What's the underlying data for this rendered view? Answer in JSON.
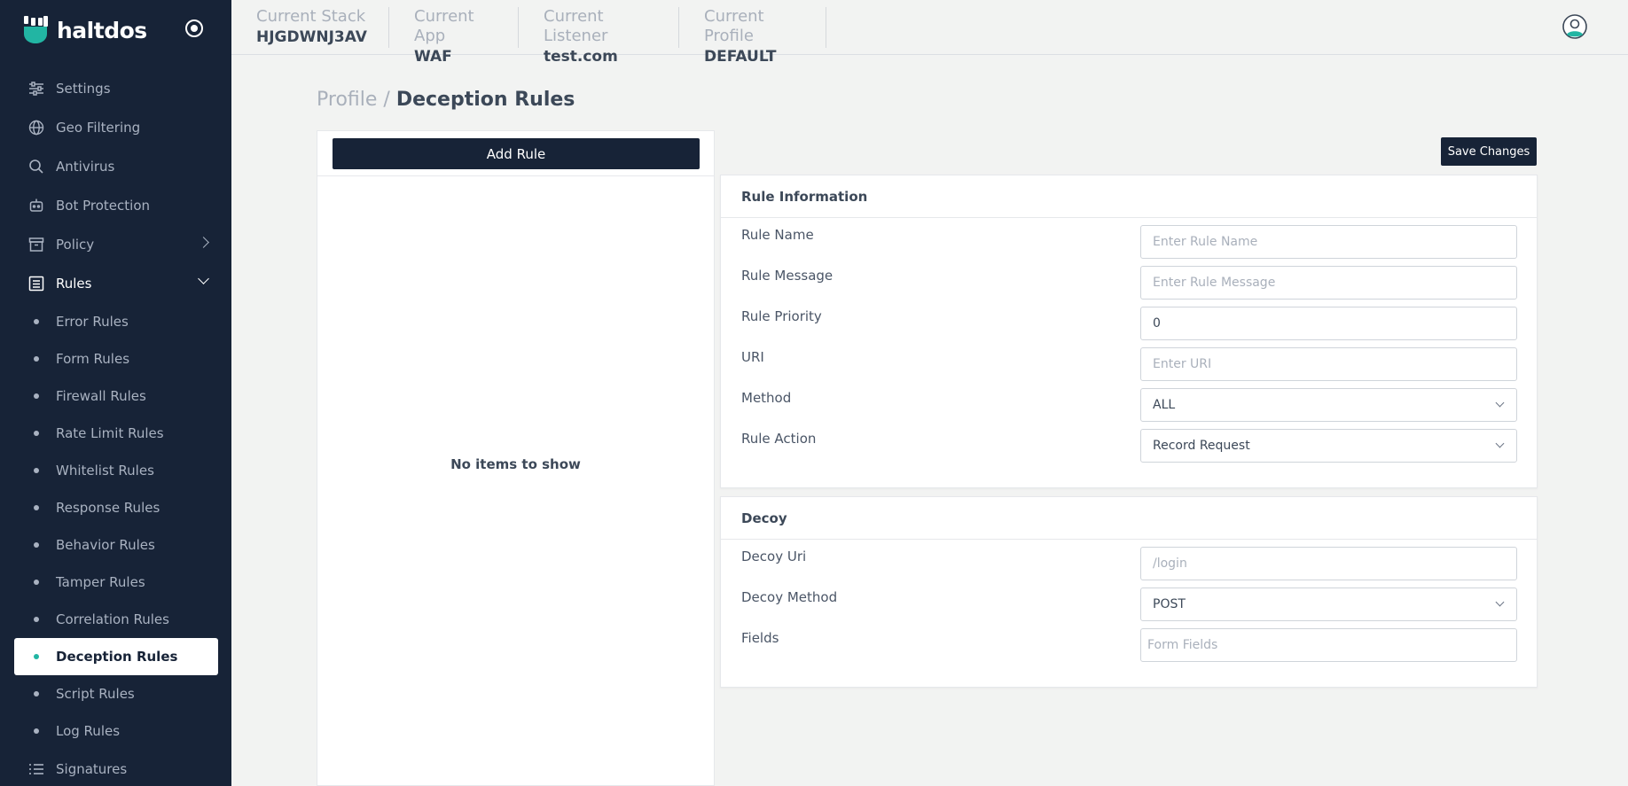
{
  "brand": {
    "name": "haltdos"
  },
  "sidebar": {
    "items": [
      {
        "label": "Settings",
        "icon": "sliders-icon"
      },
      {
        "label": "Geo Filtering",
        "icon": "globe-icon"
      },
      {
        "label": "Antivirus",
        "icon": "search-icon"
      },
      {
        "label": "Bot Protection",
        "icon": "robot-icon"
      },
      {
        "label": "Policy",
        "icon": "archive-icon"
      },
      {
        "label": "Rules",
        "icon": "list-icon"
      }
    ],
    "rules_sub": [
      {
        "label": "Error Rules"
      },
      {
        "label": "Form Rules"
      },
      {
        "label": "Firewall Rules"
      },
      {
        "label": "Rate Limit Rules"
      },
      {
        "label": "Whitelist Rules"
      },
      {
        "label": "Response Rules"
      },
      {
        "label": "Behavior Rules"
      },
      {
        "label": "Tamper Rules"
      },
      {
        "label": "Correlation Rules"
      },
      {
        "label": "Deception Rules"
      },
      {
        "label": "Script Rules"
      },
      {
        "label": "Log Rules"
      }
    ],
    "signatures": {
      "label": "Signatures",
      "icon": "list-icon"
    },
    "active_sub": "Deception Rules"
  },
  "topbar": {
    "contexts": [
      {
        "label": "Current Stack",
        "value": "HJGDWNJ3AV"
      },
      {
        "label": "Current App",
        "value": "WAF"
      },
      {
        "label": "Current Listener",
        "value": "test.com"
      },
      {
        "label": "Current Profile",
        "value": "DEFAULT"
      }
    ]
  },
  "breadcrumb": {
    "root": "Profile",
    "separator": "/",
    "current": "Deception Rules"
  },
  "list_panel": {
    "add_button": "Add Rule",
    "empty_message": "No items to show"
  },
  "save_button": "Save Changes",
  "rule_info": {
    "title": "Rule Information",
    "rule_name": {
      "label": "Rule Name",
      "value": "",
      "placeholder": "Enter Rule Name"
    },
    "rule_message": {
      "label": "Rule Message",
      "value": "",
      "placeholder": "Enter Rule Message"
    },
    "rule_priority": {
      "label": "Rule Priority",
      "value": "0",
      "placeholder": ""
    },
    "uri": {
      "label": "URI",
      "value": "",
      "placeholder": "Enter URI"
    },
    "method": {
      "label": "Method",
      "value": "ALL"
    },
    "rule_action": {
      "label": "Rule Action",
      "value": "Record Request"
    }
  },
  "decoy": {
    "title": "Decoy",
    "decoy_uri": {
      "label": "Decoy Uri",
      "value": "",
      "placeholder": "/login"
    },
    "decoy_method": {
      "label": "Decoy Method",
      "value": "POST"
    },
    "fields": {
      "label": "Fields",
      "value": "",
      "placeholder": "Form Fields"
    }
  },
  "colors": {
    "sidebar_bg": "#172337",
    "accent": "#22b5a3",
    "button_bg": "#172337"
  }
}
